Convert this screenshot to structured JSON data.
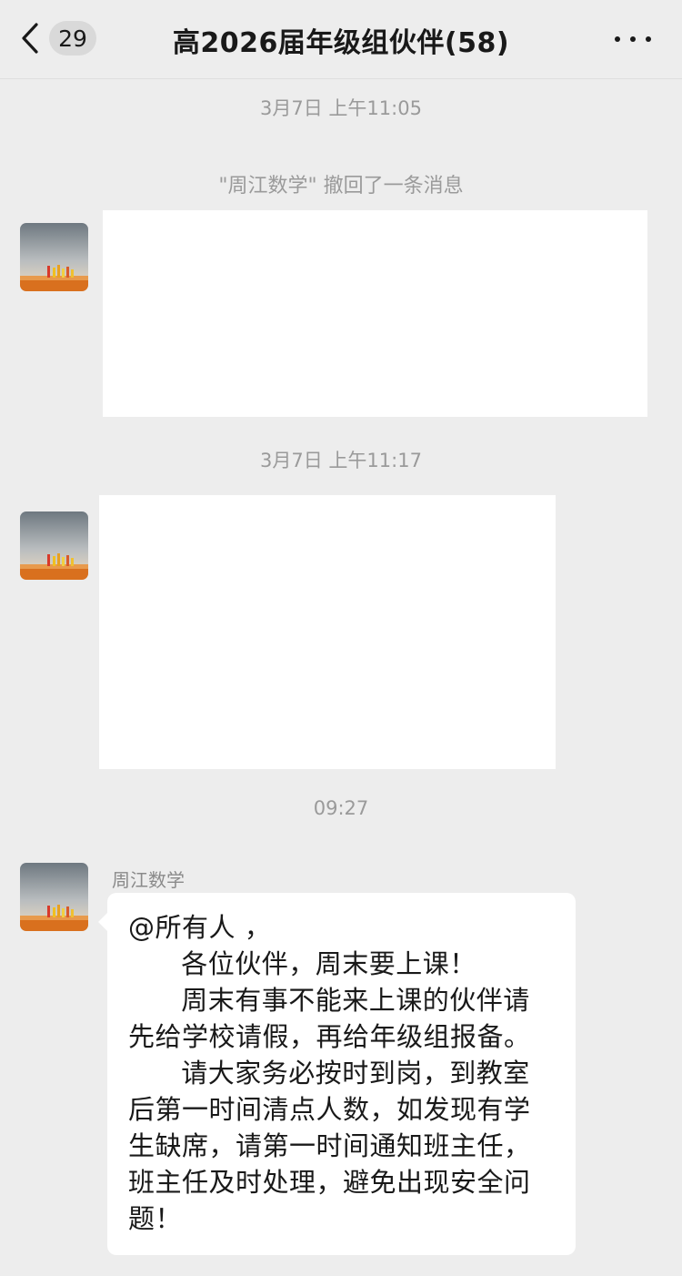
{
  "header": {
    "back_icon": "chevron-left-icon",
    "unread_count": "29",
    "title": "高2026届年级组伙伴(58)",
    "more_icon": "more-dots-icon"
  },
  "messages": {
    "time_1": "3月7日 上午11:05",
    "recall_notice": "\"周江数学\" 撤回了一条消息",
    "time_2": "3月7日 上午11:17",
    "time_3": "09:27",
    "sender_name": "周江数学",
    "text_lines": [
      "@所有人 ，",
      "      各位伙伴，周末要上课！",
      "      周末有事不能来上课的伙伴请",
      "先给学校请假，再给年级组报备。",
      "      请大家务必按时到岗，到教室",
      "后第一时间清点人数，如发现有学",
      "生缺席，请第一时间通知班主任，",
      "班主任及时处理，避免出现安全问",
      "题！"
    ]
  }
}
